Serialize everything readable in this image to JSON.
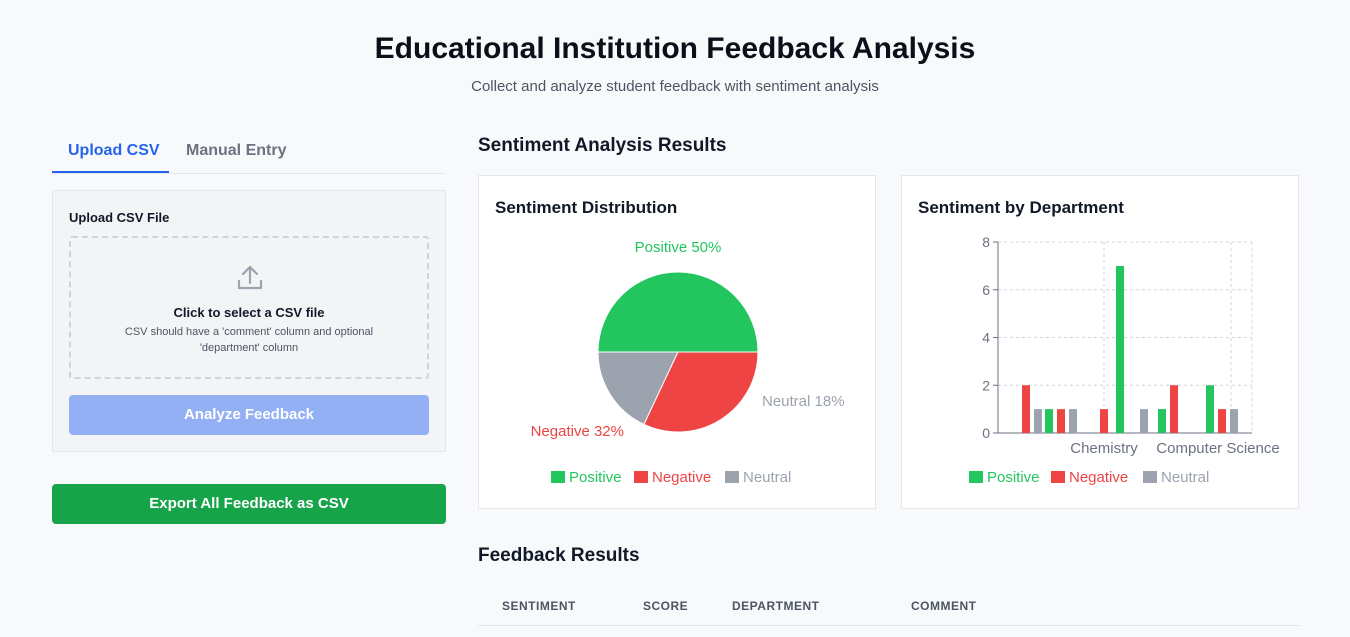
{
  "header": {
    "title": "Educational Institution Feedback Analysis",
    "subtitle": "Collect and analyze student feedback with sentiment analysis"
  },
  "tabs": [
    {
      "label": "Upload CSV",
      "active": true
    },
    {
      "label": "Manual Entry",
      "active": false
    }
  ],
  "upload": {
    "label": "Upload CSV File",
    "dropzone_title": "Click to select a CSV file",
    "dropzone_hint": "CSV should have a 'comment' column and optional 'department' column",
    "upload_icon": "upload-icon",
    "analyze_button": "Analyze Feedback"
  },
  "export_button": "Export All Feedback as CSV",
  "results": {
    "title": "Sentiment Analysis Results"
  },
  "colors": {
    "positive": "#22c55e",
    "negative": "#ef4444",
    "neutral": "#9ca3af",
    "accent": "#2563eb",
    "export": "#16a34a"
  },
  "chart_data": [
    {
      "type": "pie",
      "title": "Sentiment Distribution",
      "slices": [
        {
          "label": "Positive 50%",
          "name": "Positive",
          "value": 50,
          "color": "#22c55e"
        },
        {
          "label": "Neutral 18%",
          "name": "Neutral",
          "value": 18,
          "color": "#9ca3af"
        },
        {
          "label": "Negative 32%",
          "name": "Negative",
          "value": 32,
          "color": "#ef4444"
        }
      ],
      "legend": [
        "Positive",
        "Negative",
        "Neutral"
      ],
      "legend_position": "bottom"
    },
    {
      "type": "bar",
      "title": "Sentiment by Department",
      "categories": [
        "",
        "",
        "Chemistry",
        "",
        "Computer Science"
      ],
      "series": [
        {
          "name": "Positive",
          "color": "#22c55e",
          "values": [
            0,
            1,
            0,
            7,
            1,
            2
          ]
        },
        {
          "name": "Negative",
          "color": "#ef4444",
          "values": [
            2,
            1,
            1,
            0,
            2,
            1
          ]
        },
        {
          "name": "Neutral",
          "color": "#9ca3af",
          "values": [
            1,
            1,
            0,
            1,
            0,
            1
          ]
        }
      ],
      "x_tick_labels": [
        "Chemistry",
        "Computer Science"
      ],
      "ylim": [
        0,
        8
      ],
      "yticks": [
        0,
        2,
        4,
        6,
        8
      ],
      "grid": true,
      "legend": [
        "Positive",
        "Negative",
        "Neutral"
      ],
      "legend_position": "bottom"
    }
  ],
  "feedback": {
    "title": "Feedback Results",
    "columns": [
      "SENTIMENT",
      "SCORE",
      "DEPARTMENT",
      "COMMENT"
    ]
  }
}
